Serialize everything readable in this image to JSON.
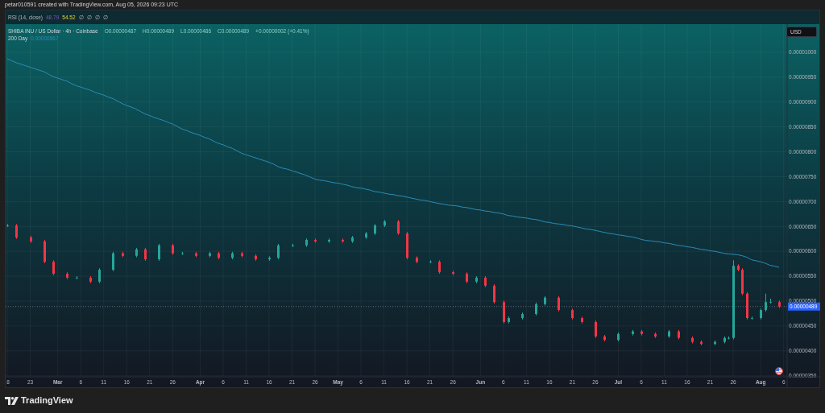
{
  "header": {
    "text": "petar010591 created with TradingView.com, Aug 05, 2026 09:23 UTC"
  },
  "rsi_legend": {
    "title": "RSI (14, close)",
    "value_1": "48.79",
    "value_2": "54.52",
    "markers": [
      "∅",
      "∅",
      "∅",
      "∅"
    ]
  },
  "legend": {
    "symbol": "SHIBA INU / US Dollar · 4h · Coinbase",
    "ohlc": [
      "O0.00000487",
      "H0.00000489",
      "L0.00000486",
      "C0.00000489"
    ],
    "change": "+0.00000002 (+0.41%)",
    "ma_value": "0.00000567"
  },
  "currency_button": {
    "label": "USD"
  },
  "price_label": {
    "text": "0.00000489"
  },
  "chart_data": {
    "type": "candlestick",
    "grid": true,
    "ylim": [
      3.495e-06,
      1.0566e-05
    ],
    "ref_lines": [
      {
        "axis": "y",
        "value": 4.89e-06
      }
    ],
    "categories": [
      "8",
      null,
      null,
      null,
      null,
      "23",
      null,
      null,
      null,
      null,
      null,
      "Mar",
      null,
      null,
      null,
      null,
      "6",
      null,
      null,
      null,
      null,
      "11",
      null,
      null,
      null,
      null,
      "16",
      null,
      null,
      null,
      null,
      "21",
      null,
      null,
      null,
      null,
      "26",
      null,
      null,
      null,
      null,
      null,
      "Apr",
      null,
      null,
      null,
      null,
      "6",
      null,
      null,
      null,
      null,
      "11",
      null,
      null,
      null,
      null,
      "16",
      null,
      null,
      null,
      null,
      "21",
      null,
      null,
      null,
      null,
      "26",
      null,
      null,
      null,
      null,
      "May",
      null,
      null,
      null,
      null,
      "6",
      null,
      null,
      null,
      null,
      "11",
      null,
      null,
      null,
      null,
      "16",
      null,
      null,
      null,
      null,
      "21",
      null,
      null,
      null,
      null,
      "26",
      null,
      null,
      null,
      null,
      null,
      "Jun",
      null,
      null,
      null,
      null,
      "6",
      null,
      null,
      null,
      null,
      "11",
      null,
      null,
      null,
      null,
      "16",
      null,
      null,
      null,
      null,
      "21",
      null,
      null,
      null,
      null,
      "26",
      null,
      null,
      null,
      null,
      "Jul",
      null,
      null,
      null,
      null,
      "6",
      null,
      null,
      null,
      null,
      "11",
      null,
      null,
      null,
      null,
      "16",
      null,
      null,
      null,
      null,
      "21",
      null,
      null,
      null,
      null,
      "26",
      null,
      null,
      null,
      null,
      null,
      "Aug",
      null,
      null,
      null,
      null,
      "6"
    ],
    "ohlc": [
      [
        6.52e-06,
        6.55e-06,
        6.49e-06,
        6.52e-06
      ],
      null,
      [
        6.52e-06,
        6.55e-06,
        6.25e-06,
        6.28e-06
      ],
      null,
      null,
      [
        6.28e-06,
        6.31e-06,
        6.17e-06,
        6.2e-06
      ],
      null,
      null,
      [
        6.2e-06,
        6.23e-06,
        5.76e-06,
        5.79e-06
      ],
      null,
      [
        5.79e-06,
        5.82e-06,
        5.52e-06,
        5.55e-06
      ],
      null,
      null,
      [
        5.55e-06,
        5.58e-06,
        5.44e-06,
        5.47e-06
      ],
      null,
      [
        5.47e-06,
        5.5e-06,
        5.44e-06,
        5.47e-06
      ],
      null,
      null,
      [
        5.47e-06,
        5.5e-06,
        5.36e-06,
        5.39e-06
      ],
      null,
      [
        5.39e-06,
        5.66e-06,
        5.36e-06,
        5.63e-06
      ],
      null,
      null,
      [
        5.63e-06,
        5.99e-06,
        5.6e-06,
        5.96e-06
      ],
      null,
      [
        5.96e-06,
        5.99e-06,
        5.88e-06,
        5.91e-06
      ],
      null,
      null,
      [
        5.91e-06,
        6.07e-06,
        5.88e-06,
        6.04e-06
      ],
      null,
      [
        6.04e-06,
        6.07e-06,
        5.81e-06,
        5.84e-06
      ],
      null,
      null,
      [
        5.84e-06,
        6.15e-06,
        5.81e-06,
        6.12e-06
      ],
      null,
      null,
      [
        6.12e-06,
        6.15e-06,
        5.93e-06,
        5.96e-06
      ],
      null,
      [
        5.96e-06,
        5.99e-06,
        5.93e-06,
        5.96e-06
      ],
      null,
      null,
      [
        5.96e-06,
        5.99e-06,
        5.88e-06,
        5.91e-06
      ],
      null,
      null,
      [
        5.91e-06,
        5.99e-06,
        5.88e-06,
        5.96e-06
      ],
      null,
      [
        5.96e-06,
        5.99e-06,
        5.84e-06,
        5.87e-06
      ],
      null,
      null,
      [
        5.87e-06,
        5.99e-06,
        5.84e-06,
        5.96e-06
      ],
      null,
      [
        5.96e-06,
        5.99e-06,
        5.88e-06,
        5.91e-06
      ],
      null,
      null,
      [
        5.91e-06,
        5.94e-06,
        5.81e-06,
        5.84e-06
      ],
      null,
      null,
      [
        5.84e-06,
        5.9e-06,
        5.81e-06,
        5.87e-06
      ],
      null,
      [
        5.87e-06,
        6.15e-06,
        5.84e-06,
        6.12e-06
      ],
      null,
      null,
      [
        6.12e-06,
        6.15e-06,
        6.09e-06,
        6.12e-06
      ],
      null,
      null,
      [
        6.12e-06,
        6.26e-06,
        6.09e-06,
        6.23e-06
      ],
      null,
      [
        6.23e-06,
        6.26e-06,
        6.17e-06,
        6.2e-06
      ],
      null,
      null,
      [
        6.2e-06,
        6.26e-06,
        6.17e-06,
        6.23e-06
      ],
      null,
      null,
      [
        6.23e-06,
        6.26e-06,
        6.17e-06,
        6.2e-06
      ],
      null,
      [
        6.2e-06,
        6.31e-06,
        6.17e-06,
        6.28e-06
      ],
      null,
      null,
      [
        6.28e-06,
        6.39e-06,
        6.25e-06,
        6.36e-06
      ],
      null,
      [
        6.36e-06,
        6.55e-06,
        6.33e-06,
        6.52e-06
      ],
      null,
      [
        6.52e-06,
        6.63e-06,
        6.49e-06,
        6.6e-06
      ],
      null,
      null,
      [
        6.6e-06,
        6.63e-06,
        6.33e-06,
        6.36e-06
      ],
      null,
      [
        6.36e-06,
        6.39e-06,
        5.84e-06,
        5.87e-06
      ],
      null,
      [
        5.87e-06,
        5.9e-06,
        5.76e-06,
        5.79e-06
      ],
      null,
      null,
      [
        5.79e-06,
        5.82e-06,
        5.76e-06,
        5.79e-06
      ],
      null,
      [
        5.79e-06,
        5.82e-06,
        5.55e-06,
        5.58e-06
      ],
      null,
      null,
      [
        5.58e-06,
        5.61e-06,
        5.52e-06,
        5.55e-06
      ],
      null,
      null,
      [
        5.55e-06,
        5.58e-06,
        5.36e-06,
        5.39e-06
      ],
      null,
      [
        5.39e-06,
        5.5e-06,
        5.36e-06,
        5.47e-06
      ],
      null,
      [
        5.47e-06,
        5.5e-06,
        5.28e-06,
        5.31e-06
      ],
      null,
      [
        5.31e-06,
        5.34e-06,
        4.95e-06,
        4.98e-06
      ],
      null,
      [
        4.98e-06,
        5.01e-06,
        4.55e-06,
        4.58e-06
      ],
      [
        4.58e-06,
        4.69e-06,
        4.55e-06,
        4.66e-06
      ],
      null,
      null,
      [
        4.66e-06,
        4.77e-06,
        4.63e-06,
        4.74e-06
      ],
      null,
      null,
      [
        4.74e-06,
        4.97e-06,
        4.71e-06,
        4.94e-06
      ],
      null,
      [
        4.94e-06,
        5.1e-06,
        4.91e-06,
        5.07e-06
      ],
      null,
      null,
      [
        5.07e-06,
        5.1e-06,
        4.79e-06,
        4.82e-06
      ],
      null,
      null,
      [
        4.82e-06,
        4.85e-06,
        4.63e-06,
        4.66e-06
      ],
      null,
      [
        4.66e-06,
        4.69e-06,
        4.55e-06,
        4.58e-06
      ],
      null,
      null,
      [
        4.58e-06,
        4.61e-06,
        4.26e-06,
        4.29e-06
      ],
      null,
      [
        4.29e-06,
        4.32e-06,
        4.19e-06,
        4.22e-06
      ],
      null,
      null,
      [
        4.22e-06,
        4.37e-06,
        4.19e-06,
        4.34e-06
      ],
      null,
      null,
      [
        4.34e-06,
        4.42e-06,
        4.31e-06,
        4.39e-06
      ],
      null,
      [
        4.39e-06,
        4.42e-06,
        4.31e-06,
        4.34e-06
      ],
      null,
      null,
      [
        4.34e-06,
        4.37e-06,
        4.26e-06,
        4.29e-06
      ],
      null,
      null,
      [
        4.29e-06,
        4.42e-06,
        4.26e-06,
        4.39e-06
      ],
      null,
      [
        4.39e-06,
        4.42e-06,
        4.23e-06,
        4.26e-06
      ],
      null,
      null,
      [
        4.26e-06,
        4.29e-06,
        4.15e-06,
        4.18e-06
      ],
      null,
      [
        4.18e-06,
        4.21e-06,
        4.11e-06,
        4.14e-06
      ],
      null,
      null,
      [
        4.14e-06,
        4.21e-06,
        4.11e-06,
        4.18e-06
      ],
      null,
      [
        4.18e-06,
        4.29e-06,
        4.15e-06,
        4.26e-06
      ],
      [
        4.26e-06,
        4.29e-06,
        4.23e-06,
        4.26e-06
      ],
      [
        4.26e-06,
        5.82e-06,
        4.23e-06,
        5.71e-06
      ],
      [
        5.71e-06,
        5.74e-06,
        5.6e-06,
        5.63e-06
      ],
      [
        5.63e-06,
        5.66e-06,
        5.12e-06,
        5.15e-06
      ],
      [
        5.15e-06,
        5.18e-06,
        4.63e-06,
        4.66e-06
      ],
      [
        4.66e-06,
        4.69e-06,
        4.63e-06,
        4.66e-06
      ],
      null,
      [
        4.66e-06,
        4.85e-06,
        4.63e-06,
        4.82e-06
      ],
      [
        4.82e-06,
        5.15e-06,
        4.79e-06,
        4.98e-06
      ],
      [
        4.98e-06,
        5.05e-06,
        4.95e-06,
        4.98e-06
      ],
      null,
      [
        4.98e-06,
        5.01e-06,
        4.86e-06,
        4.89e-06
      ],
      null
    ],
    "series": [
      {
        "name": "200 Day",
        "type": "line",
        "color": "#2b8cb5",
        "values": [
          9.87e-06,
          9.83e-06,
          9.79e-06,
          9.76e-06,
          9.73e-06,
          9.7e-06,
          9.67e-06,
          9.64e-06,
          9.61e-06,
          9.56e-06,
          9.51e-06,
          9.48e-06,
          9.45e-06,
          9.42e-06,
          9.37e-06,
          9.33e-06,
          9.3e-06,
          9.27e-06,
          9.24e-06,
          9.2e-06,
          9.17e-06,
          9.14e-06,
          9.1e-06,
          9.07e-06,
          9.02e-06,
          8.97e-06,
          8.93e-06,
          8.9e-06,
          8.86e-06,
          8.81e-06,
          8.76e-06,
          8.73e-06,
          8.69e-06,
          8.66e-06,
          8.63e-06,
          8.59e-06,
          8.56e-06,
          8.51e-06,
          8.46e-06,
          8.43e-06,
          8.39e-06,
          8.36e-06,
          8.33e-06,
          8.29e-06,
          8.26e-06,
          8.21e-06,
          8.17e-06,
          8.14e-06,
          8.1e-06,
          8.07e-06,
          8.02e-06,
          7.97e-06,
          7.94e-06,
          7.91e-06,
          7.88e-06,
          7.85e-06,
          7.82e-06,
          7.79e-06,
          7.75e-06,
          7.7e-06,
          7.67e-06,
          7.65e-06,
          7.62e-06,
          7.59e-06,
          7.56e-06,
          7.53e-06,
          7.49e-06,
          7.45e-06,
          7.43e-06,
          7.42e-06,
          7.4e-06,
          7.38e-06,
          7.37e-06,
          7.35e-06,
          7.33e-06,
          7.3e-06,
          7.28e-06,
          7.27e-06,
          7.25e-06,
          7.23e-06,
          7.2e-06,
          7.19e-06,
          7.17e-06,
          7.15e-06,
          7.14e-06,
          7.12e-06,
          7.11e-06,
          7.09e-06,
          7.07e-06,
          7.05e-06,
          7.03e-06,
          7.02e-06,
          7e-06,
          6.98e-06,
          6.96e-06,
          6.95e-06,
          6.93e-06,
          6.92e-06,
          6.91e-06,
          6.89e-06,
          6.88e-06,
          6.86e-06,
          6.84e-06,
          6.83e-06,
          6.81e-06,
          6.8e-06,
          6.78e-06,
          6.77e-06,
          6.75e-06,
          6.72e-06,
          6.71e-06,
          6.69e-06,
          6.68e-06,
          6.67e-06,
          6.65e-06,
          6.64e-06,
          6.62e-06,
          6.59e-06,
          6.58e-06,
          6.56e-06,
          6.55e-06,
          6.54e-06,
          6.52e-06,
          6.51e-06,
          6.49e-06,
          6.47e-06,
          6.45e-06,
          6.44e-06,
          6.42e-06,
          6.4e-06,
          6.38e-06,
          6.36e-06,
          6.35e-06,
          6.33e-06,
          6.32e-06,
          6.3e-06,
          6.29e-06,
          6.27e-06,
          6.24e-06,
          6.22e-06,
          6.21e-06,
          6.2e-06,
          6.19e-06,
          6.17e-06,
          6.16e-06,
          6.14e-06,
          6.12e-06,
          6.11e-06,
          6.09e-06,
          6.08e-06,
          6.06e-06,
          6.04e-06,
          6.03e-06,
          6.01e-06,
          6e-06,
          5.98e-06,
          5.96e-06,
          5.95e-06,
          5.94e-06,
          5.93e-06,
          5.91e-06,
          5.88e-06,
          5.83e-06,
          5.81e-06,
          5.79e-06,
          5.76e-06,
          5.72e-06,
          5.7e-06,
          5.68e-06,
          null
        ]
      }
    ],
    "yticks": [
      {
        "value": 1e-05,
        "label": "0.00001000"
      },
      {
        "value": 9.5e-06,
        "label": "0.00000950"
      },
      {
        "value": 9e-06,
        "label": "0.00000900"
      },
      {
        "value": 8.5e-06,
        "label": "0.00000850"
      },
      {
        "value": 8e-06,
        "label": "0.00000800"
      },
      {
        "value": 7.5e-06,
        "label": "0.00000750"
      },
      {
        "value": 7e-06,
        "label": "0.00000700"
      },
      {
        "value": 6.5e-06,
        "label": "0.00000650"
      },
      {
        "value": 6e-06,
        "label": "0.00000600"
      },
      {
        "value": 5.5e-06,
        "label": "0.00000550"
      },
      {
        "value": 5e-06,
        "label": "0.00000500"
      },
      {
        "value": 4.5e-06,
        "label": "0.00000450"
      },
      {
        "value": 4e-06,
        "label": "0.00000400"
      },
      {
        "value": 3.5e-06,
        "label": "0.00000350"
      }
    ]
  },
  "footer": {
    "logo_text": "TradingView"
  }
}
